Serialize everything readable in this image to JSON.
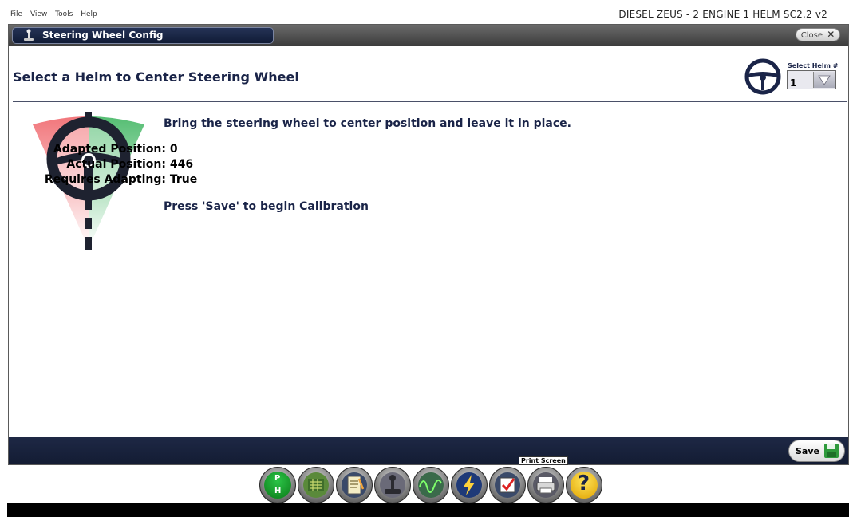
{
  "menu": {
    "items": [
      "File",
      "View",
      "Tools",
      "Help"
    ]
  },
  "app_title": "DIESEL ZEUS - 2 ENGINE 1 HELM SC2.2 v2",
  "window": {
    "title": "Steering Wheel Config",
    "close_label": "Close",
    "close_glyph": "✕"
  },
  "header": {
    "title": "Select a Helm to Center Steering Wheel",
    "helm_label": "Select Helm #",
    "helm_value": "1"
  },
  "content": {
    "instruction": "Bring the steering wheel to center position and leave it in place.",
    "fields": [
      {
        "label": "Adapted Position:",
        "value": "0"
      },
      {
        "label": "Actual Position:",
        "value": "446"
      },
      {
        "label": "Requires Adapting:",
        "value": "True"
      }
    ],
    "save_hint": "Press 'Save' to begin Calibration"
  },
  "footer": {
    "save_label": "Save"
  },
  "toolbar": {
    "tooltip": "Print Screen",
    "buttons": [
      {
        "name": "ph-mode-icon",
        "text_top": "P",
        "text_bottom": "H"
      },
      {
        "name": "circuit-board-icon"
      },
      {
        "name": "notepad-icon"
      },
      {
        "name": "joystick-icon"
      },
      {
        "name": "waveform-icon"
      },
      {
        "name": "lightning-icon"
      },
      {
        "name": "checklist-icon"
      },
      {
        "name": "printer-icon"
      },
      {
        "name": "help-icon",
        "text": "?"
      }
    ]
  },
  "colors": {
    "title_text": "#1a2448",
    "bottom_bar": "#1a2340",
    "toolbar_green": "#0f8a1c",
    "help_yellow": "#f4c20f",
    "save_disk_green": "#2e9a3b"
  }
}
